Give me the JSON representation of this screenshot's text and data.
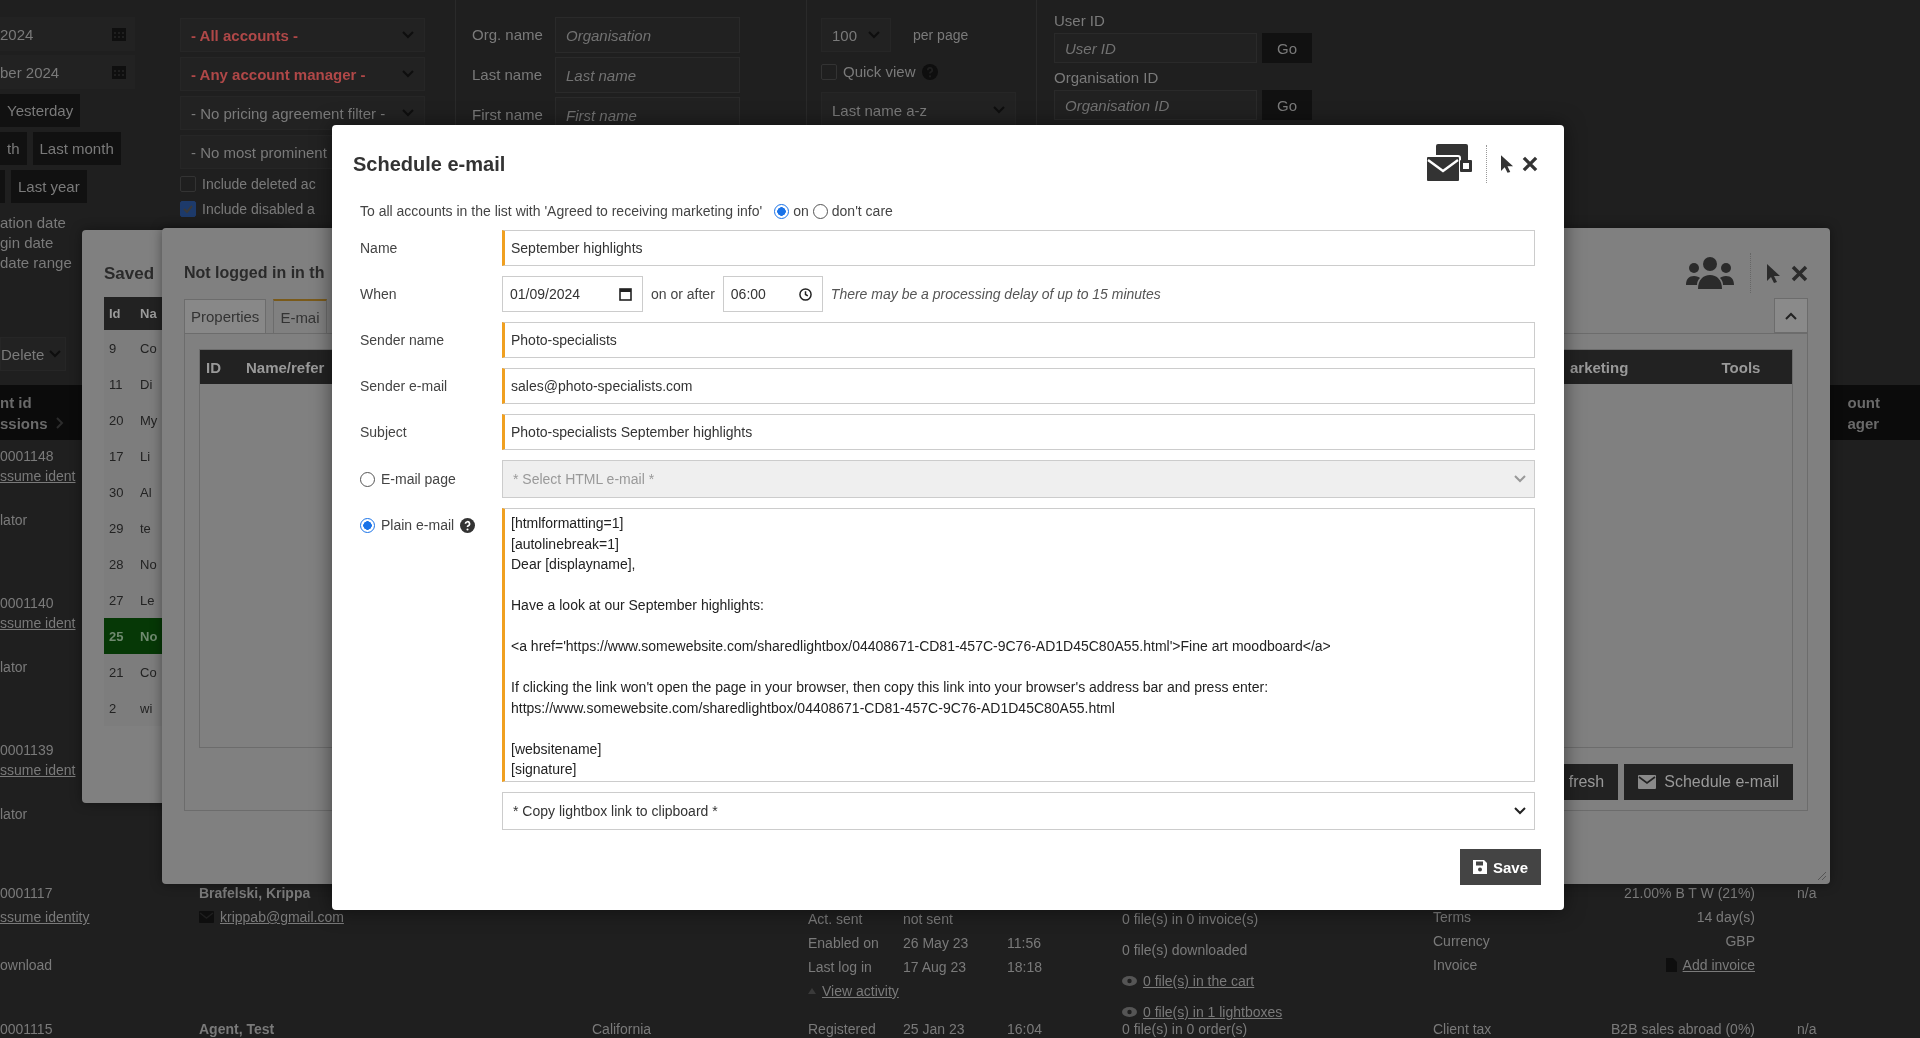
{
  "page": {
    "date_fields": [
      {
        "value": "2024"
      },
      {
        "value": "ber 2024"
      }
    ],
    "quick_ranges": [
      {
        "items": [
          {
            "kind": "button",
            "label": "Yesterday"
          }
        ]
      },
      {
        "items": [
          {
            "kind": "button",
            "label": "th"
          },
          {
            "kind": "button",
            "label": "Last month"
          }
        ]
      },
      {
        "items": [
          {
            "kind": "stub"
          },
          {
            "kind": "button",
            "label": "Last year"
          }
        ]
      }
    ],
    "date_options": [
      "ation date",
      "gin date",
      "date range"
    ],
    "filters": {
      "selects": [
        {
          "value": "- All accounts -",
          "highlighted": true
        },
        {
          "value": "- Any account manager -",
          "highlighted": true
        },
        {
          "value": "- No pricing agreement filter -",
          "highlighted": false
        },
        {
          "value": "- No most prominent",
          "highlighted": false
        }
      ],
      "checkboxes": [
        {
          "label": "Include deleted ac",
          "checked": false
        },
        {
          "label": "Include disabled a",
          "checked": true
        }
      ]
    },
    "search": [
      {
        "label": "Org. name",
        "placeholder": "Organisation"
      },
      {
        "label": "Last name",
        "placeholder": "Last name"
      },
      {
        "label": "First name",
        "placeholder": "First name"
      }
    ],
    "user_list": {
      "per_page": "100",
      "per_page_label": "per page",
      "quick_view": {
        "label": "Quick view",
        "checked": false
      },
      "sort": "Last name a-z"
    },
    "find_by": [
      {
        "label": "User ID",
        "placeholder": "User ID",
        "button": "Go"
      },
      {
        "label": "Organisation ID",
        "placeholder": "Organisation ID",
        "button": "Go"
      }
    ],
    "bulk_action": "Delete",
    "header": {
      "column_1": [
        "nt id",
        "ssions"
      ],
      "column_last": [
        "ount",
        "ager"
      ]
    },
    "rows": [
      {
        "id": "0001148",
        "link": "ssume ident",
        "note": "lator"
      },
      {
        "id": "0001140",
        "link": "ssume ident",
        "note": "lator"
      },
      {
        "id": "0001139",
        "link": "ssume ident",
        "note": "lator"
      },
      {
        "id": "0001117",
        "link": "ssume identity",
        "note": "ownload",
        "details": {
          "name": "Brafelski, Krippa",
          "email": "krippab@gmail.com",
          "activity": [
            {
              "label": "Act. sent",
              "date": "not sent"
            },
            {
              "label": "Enabled on",
              "date": "26 May 23",
              "time": "11:56"
            },
            {
              "label": "Last log in",
              "date": "17 Aug 23",
              "time": "18:18"
            }
          ],
          "view_activity": "View activity",
          "files": [
            {
              "text": "0 file(s) in 0 invoice(s)",
              "link": false
            },
            {
              "text": "0 file(s) downloaded",
              "link": false
            },
            {
              "text": "0 file(s) in the cart",
              "link": true
            },
            {
              "text": "0 file(s) in 1 lightboxes",
              "link": true
            }
          ],
          "terms": [
            {
              "value": "21.00% B T W (21%)"
            },
            {
              "label": "Terms",
              "value": "14 day(s)"
            },
            {
              "label": "Currency",
              "value": "GBP"
            },
            {
              "label": "Invoice",
              "value": "Add invoice",
              "kind": "link"
            }
          ],
          "status": "n/a"
        }
      },
      {
        "id": "0001115",
        "details": {
          "name": "Agent, Test",
          "region": "California",
          "activity": [
            {
              "label": "Registered",
              "date": "25 Jan 23",
              "time": "16:04"
            }
          ],
          "files": [
            {
              "text": "0 file(s) in 0 order(s)",
              "link": false
            }
          ],
          "terms": [
            {
              "label": "Client tax",
              "value": "B2B sales abroad (0%)"
            }
          ],
          "status": "n/a"
        }
      }
    ]
  },
  "saved_dialog": {
    "title": "Saved",
    "columns": [
      "Id",
      "Na"
    ],
    "rows": [
      {
        "id": "9",
        "name": "Co",
        "selected": false
      },
      {
        "id": "11",
        "name": "Di",
        "selected": false
      },
      {
        "id": "20",
        "name": "My",
        "selected": false
      },
      {
        "id": "17",
        "name": "Li",
        "selected": false
      },
      {
        "id": "30",
        "name": "Al",
        "selected": false
      },
      {
        "id": "29",
        "name": "te",
        "selected": false
      },
      {
        "id": "28",
        "name": "No",
        "selected": false
      },
      {
        "id": "27",
        "name": "Le",
        "selected": false
      },
      {
        "id": "25",
        "name": "No",
        "selected": true
      },
      {
        "id": "21",
        "name": "Co",
        "selected": false
      },
      {
        "id": "2",
        "name": "wi",
        "selected": false
      }
    ]
  },
  "list_dialog": {
    "title": "Not logged in in th",
    "tabs": [
      {
        "label": "Properties",
        "selected": false
      },
      {
        "label": "E-mai",
        "selected": true
      }
    ],
    "columns": [
      "ID",
      "Name/refer",
      "arketing",
      "Tools"
    ],
    "buttons": [
      {
        "label": "fresh",
        "kind": "plain"
      },
      {
        "label": "Schedule e-mail",
        "kind": "mail"
      }
    ]
  },
  "schedule_dialog": {
    "title": "Schedule e-mail",
    "audience": {
      "text": "To all accounts in the list with 'Agreed to receiving marketing info'",
      "options": [
        {
          "label": "on",
          "selected": true
        },
        {
          "label": "don't care",
          "selected": false
        }
      ]
    },
    "name": {
      "label": "Name",
      "value": "September highlights"
    },
    "when": {
      "label": "When",
      "date": "01/09/2024",
      "connector": "on or after",
      "time": "06:00",
      "note": "There may be a processing delay of up to 15 minutes"
    },
    "sender_name": {
      "label": "Sender name",
      "value": "Photo-specialists"
    },
    "sender_email": {
      "label": "Sender e-mail",
      "value": "sales@photo-specialists.com"
    },
    "subject": {
      "label": "Subject",
      "value": "Photo-specialists September highlights"
    },
    "body_options": [
      {
        "kind": "page",
        "label": "E-mail page",
        "selected": false,
        "placeholder": "* Select HTML e-mail *"
      },
      {
        "kind": "plain",
        "label": "Plain e-mail",
        "selected": true,
        "text": "[htmlformatting=1]\n[autolinebreak=1]\nDear [displayname],\n\nHave a look at our September highlights:\n\n<a href='https://www.somewebsite.com/sharedlightbox/04408671-CD81-457C-9C76-AD1D45C80A55.html'>Fine art moodboard</a>\n\nIf clicking the link won't open the page in your browser, then copy this link into your browser's address bar and press enter:\nhttps://www.somewebsite.com/sharedlightbox/04408671-CD81-457C-9C76-AD1D45C80A55.html\n\n[websitename]\n[signature]"
      }
    ],
    "link_select": "* Copy lightbox link to clipboard *",
    "save": "Save"
  }
}
